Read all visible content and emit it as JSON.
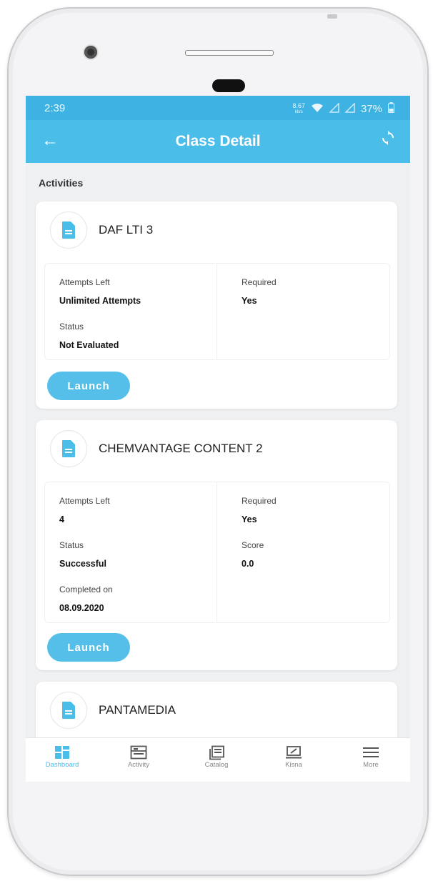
{
  "status_bar": {
    "time": "2:39",
    "speed": "8.67",
    "speed_unit": "kb/s",
    "battery": "37%"
  },
  "app_bar": {
    "title": "Class Detail"
  },
  "section": {
    "label": "Activities"
  },
  "activities": [
    {
      "title": "DAF LTI 3",
      "attempts_left_label": "Attempts Left",
      "attempts_left": "Unlimited Attempts",
      "required_label": "Required",
      "required": "Yes",
      "status_label": "Status",
      "status": "Not Evaluated",
      "launch_label": "Launch"
    },
    {
      "title": "CHEMVANTAGE CONTENT 2",
      "attempts_left_label": "Attempts Left",
      "attempts_left": "4",
      "required_label": "Required",
      "required": "Yes",
      "status_label": "Status",
      "status": "Successful",
      "score_label": "Score",
      "score": "0.0",
      "completed_label": "Completed on",
      "completed": "08.09.2020",
      "launch_label": "Launch"
    },
    {
      "title": "PANTAMEDIA"
    }
  ],
  "bottom_nav": [
    {
      "label": "Dashboard",
      "icon": "dashboard-icon",
      "active": true
    },
    {
      "label": "Activity",
      "icon": "activity-icon",
      "active": false
    },
    {
      "label": "Catalog",
      "icon": "catalog-icon",
      "active": false
    },
    {
      "label": "Kisna",
      "icon": "kisna-icon",
      "active": false
    },
    {
      "label": "More",
      "icon": "menu-icon",
      "active": false
    }
  ],
  "colors": {
    "primary": "#4bbde9",
    "status_bar": "#3db2e3",
    "background": "#eef0f2"
  }
}
